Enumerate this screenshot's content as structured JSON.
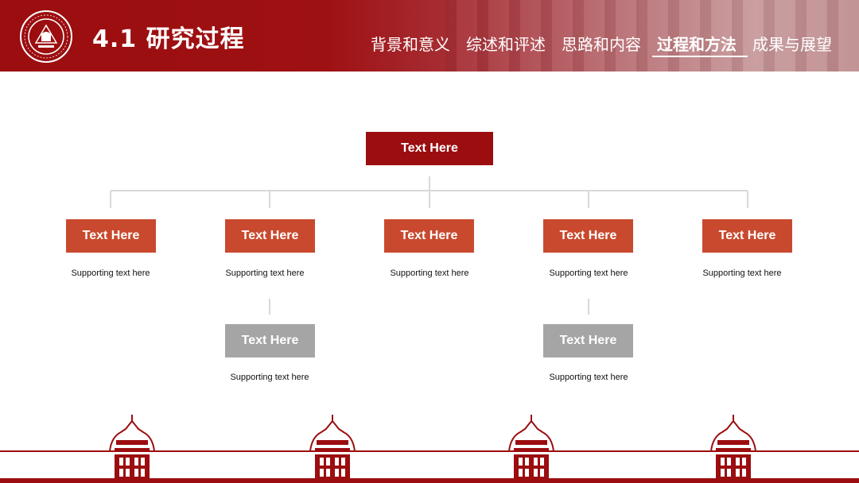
{
  "header": {
    "title": "4.1 研究过程",
    "nav": [
      {
        "label": "背景和意义",
        "active": false
      },
      {
        "label": "综述和评述",
        "active": false
      },
      {
        "label": "思路和内容",
        "active": false
      },
      {
        "label": "过程和方法",
        "active": true
      },
      {
        "label": "成果与展望",
        "active": false
      }
    ]
  },
  "colors": {
    "brand_red": "#9b0d0f",
    "box_orange": "#c9492e",
    "box_gray": "#a5a5a5",
    "connector": "#d9d9d9"
  },
  "org": {
    "root": {
      "label": "Text Here"
    },
    "children": [
      {
        "label": "Text Here",
        "support": "Supporting text here"
      },
      {
        "label": "Text Here",
        "support": "Supporting text here",
        "child": {
          "label": "Text Here",
          "support": "Supporting text here"
        }
      },
      {
        "label": "Text Here",
        "support": "Supporting text here"
      },
      {
        "label": "Text Here",
        "support": "Supporting text here",
        "child": {
          "label": "Text Here",
          "support": "Supporting text here"
        }
      },
      {
        "label": "Text Here",
        "support": "Supporting text here"
      }
    ]
  }
}
